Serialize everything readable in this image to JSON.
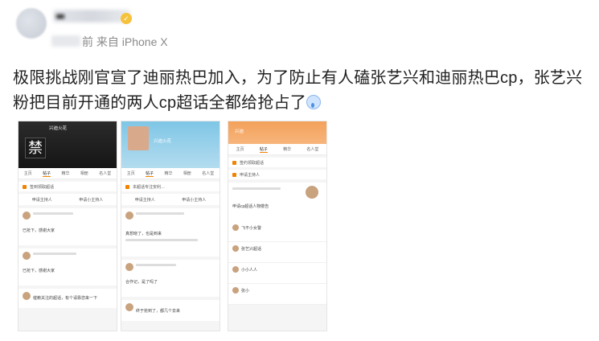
{
  "post": {
    "meta_text": "前 来自 iPhone X",
    "body": "极限挑战刚官宣了迪丽热巴加入，为了防止有人磕张艺兴和迪丽热巴cp，张艺兴粉把目前开通的两人cp超话全都给抢占了"
  },
  "screenshots": [
    {
      "title": "兴迪火花",
      "ban_char": "禁",
      "tabs": [
        "主页",
        "帖子",
        "精华",
        "相册",
        "名人堂"
      ],
      "rows": [
        "签到领取超话"
      ],
      "buttons": [
        "申请主持人",
        "申请小主持人"
      ],
      "feed_text": [
        "已抢下，感谢大家",
        "已抢下，感谢大家"
      ],
      "bottom_text": "催赖关注的超话，有个请靠您来一下"
    },
    {
      "title": "兴迪火花",
      "tabs": [
        "主页",
        "帖子",
        "精华",
        "相册",
        "名人堂"
      ],
      "rows": [
        "本超话专注安利…"
      ],
      "buttons": [
        "申请主持人",
        "申请小主持人"
      ],
      "feed_text": [
        "真想晓了，也是到来",
        "合作记，是了吗了"
      ],
      "bottom_text": "终于抢到了，都几个去来"
    },
    {
      "title": "兴迪",
      "tabs": [
        "主页",
        "帖子",
        "精华",
        "名人堂"
      ],
      "rows": [
        "签约领取超话"
      ],
      "buttons": [
        "申请主持人"
      ],
      "feed_text": [
        "申请cp超话人物敬告",
        "飞不小女警",
        "张艺兴超话",
        "小小人人",
        "张小"
      ],
      "bottom_text": ""
    }
  ]
}
